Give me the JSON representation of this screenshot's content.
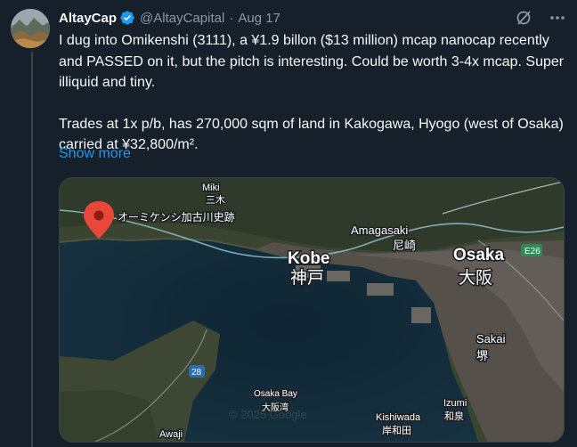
{
  "author": {
    "name": "AltayCap",
    "handle": "@AltayCapital",
    "date": "Aug 17",
    "verified": true
  },
  "icons": {
    "verified": "verified-badge-icon",
    "grok": "grok-icon",
    "more": "more-icon",
    "pin": "location-pin-icon"
  },
  "tweet": {
    "paragraph1": "I dug into Omikenshi (3111), a ¥1.9 billon ($13 million) mcap nanocap recently and PASSED on it, but the pitch is interesting. Could be worth 3-4x mcap. Super illiquid and tiny.",
    "paragraph2": "Trades at 1x p/b, has 270,000 sqm of land in Kakogawa, Hyogo (west of Osaka) carried at ¥32,800/m².",
    "show_more": "Show more"
  },
  "map": {
    "labels": {
      "miki_en": "Miki",
      "miki_jp": "三木",
      "omikenshi": "オーミケンシ加古川史跡",
      "amagasaki_en": "Amagasaki",
      "amagasaki_jp": "尼崎",
      "kobe_en": "Kobe",
      "kobe_jp": "神戸",
      "osaka_en": "Osaka",
      "osaka_jp": "大阪",
      "route_e26": "E26",
      "sakai_en": "Sakai",
      "sakai_jp": "堺",
      "route_28": "28",
      "osaka_bay_en": "Osaka Bay",
      "osaka_bay_jp": "大阪湾",
      "izumi_en": "Izumi",
      "izumi_jp": "和泉",
      "kishiwada_en": "Kishiwada",
      "kishiwada_jp": "岸和田",
      "awaji_en": "Awaji",
      "watermark": "© 2025 Google"
    }
  },
  "colors": {
    "background": "#15202b",
    "link": "#1d9bf0",
    "muted": "#8b98a5",
    "verified": "#1d9bf0",
    "pin": "#e8473a"
  }
}
